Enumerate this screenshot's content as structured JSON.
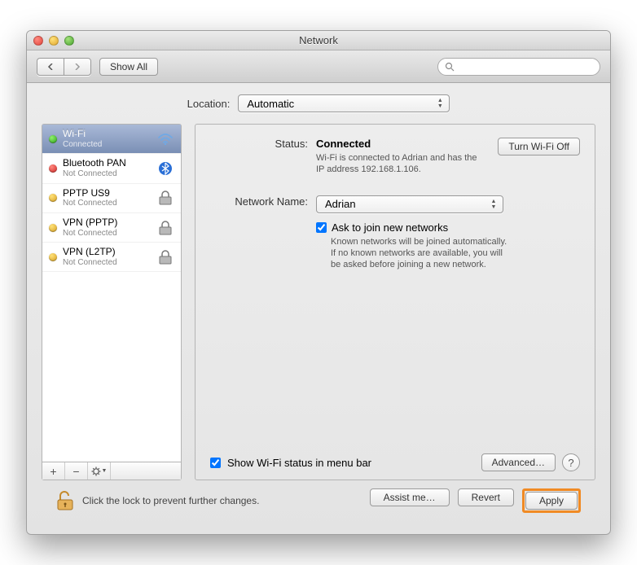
{
  "window": {
    "title": "Network"
  },
  "toolbar": {
    "show_all": "Show All",
    "search_placeholder": ""
  },
  "location": {
    "label": "Location:",
    "value": "Automatic"
  },
  "sidebar": {
    "items": [
      {
        "name": "Wi-Fi",
        "status": "Connected",
        "dot": "green",
        "icon": "wifi",
        "selected": true
      },
      {
        "name": "Bluetooth PAN",
        "status": "Not Connected",
        "dot": "red",
        "icon": "bluetooth"
      },
      {
        "name": "PPTP US9",
        "status": "Not Connected",
        "dot": "yellow",
        "icon": "lock"
      },
      {
        "name": "VPN (PPTP)",
        "status": "Not Connected",
        "dot": "yellow",
        "icon": "lock"
      },
      {
        "name": "VPN (L2TP)",
        "status": "Not Connected",
        "dot": "yellow",
        "icon": "lock"
      }
    ]
  },
  "detail": {
    "status_label": "Status:",
    "status_value": "Connected",
    "status_desc": "Wi-Fi is connected to Adrian and has the IP address 192.168.1.106.",
    "turn_off": "Turn Wi-Fi Off",
    "name_label": "Network Name:",
    "name_value": "Adrian",
    "ask_label": "Ask to join new networks",
    "ask_desc": "Known networks will be joined automatically. If no known networks are available, you will be asked before joining a new network.",
    "show_menubar": "Show Wi-Fi status in menu bar",
    "advanced": "Advanced…"
  },
  "footer": {
    "lock_text": "Click the lock to prevent further changes.",
    "assist": "Assist me…",
    "revert": "Revert",
    "apply": "Apply"
  }
}
